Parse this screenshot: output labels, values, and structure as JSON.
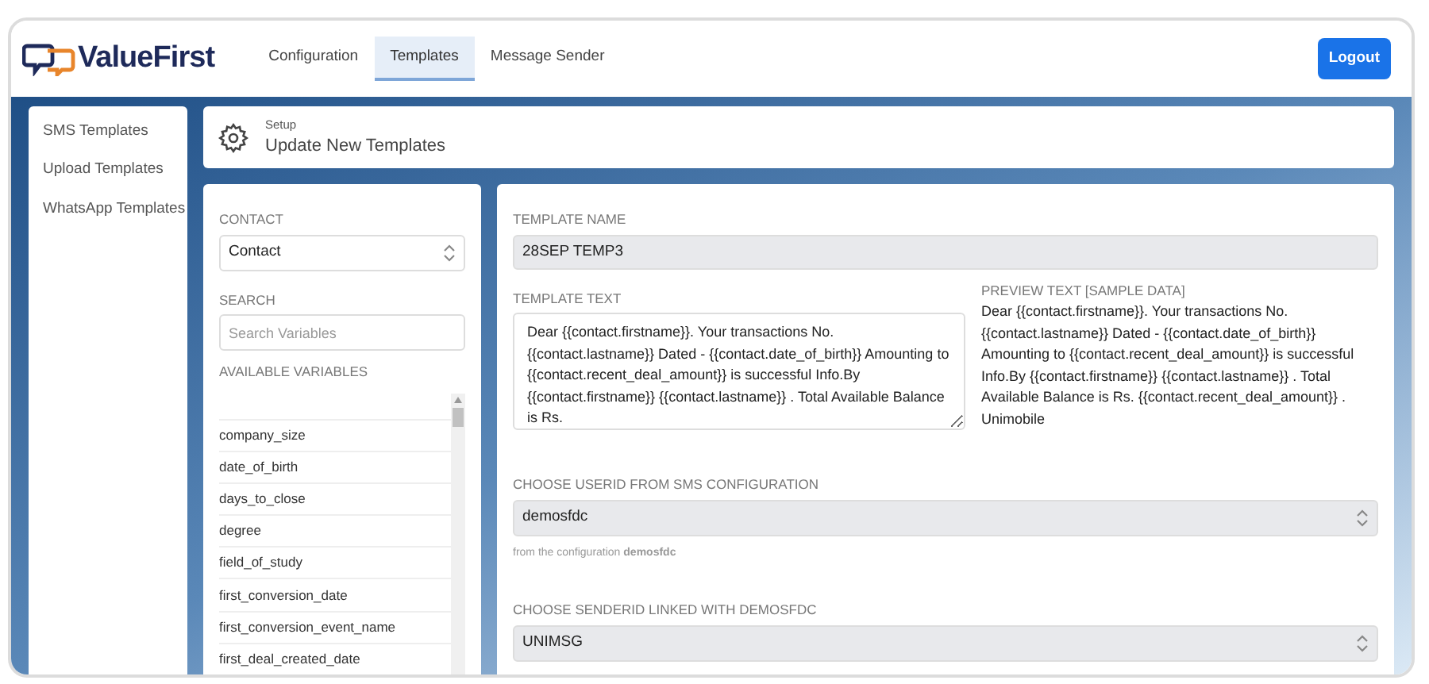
{
  "header": {
    "logo_text": "ValueFirst",
    "tabs": [
      {
        "label": "Configuration",
        "selected": false
      },
      {
        "label": "Templates",
        "selected": true
      },
      {
        "label": "Message Sender",
        "selected": false
      }
    ],
    "logout": "Logout"
  },
  "sidebar": {
    "items": [
      "SMS Templates",
      "Upload Templates",
      "WhatsApp Templates"
    ]
  },
  "page_header": {
    "eyebrow": "Setup",
    "title": "Update New Templates"
  },
  "variables_panel": {
    "contact_label": "CONTACT",
    "contact_value": "Contact",
    "search_label": "SEARCH",
    "search_placeholder": "Search Variables",
    "variables_label": "AVAILABLE VARIABLES",
    "variables": [
      "company_size",
      "date_of_birth",
      "days_to_close",
      "degree",
      "field_of_study",
      "first_conversion_date",
      "first_conversion_event_name",
      "first_deal_created_date"
    ]
  },
  "form": {
    "name_label": "TEMPLATE NAME",
    "name_value": "28SEP TEMP3",
    "text_label": "TEMPLATE TEXT",
    "text_value": "Dear {{contact.firstname}}. Your transactions No. {{contact.lastname}} Dated - {{contact.date_of_birth}} Amounting to {{contact.recent_deal_amount}} is successful Info.By {{contact.firstname}} {{contact.lastname}} . Total Available Balance is Rs.",
    "preview_label": "PREVIEW TEXT [SAMPLE DATA]",
    "preview_text": "Dear {{contact.firstname}}. Your transactions No. {{contact.lastname}} Dated - {{contact.date_of_birth}} Amounting to {{contact.recent_deal_amount}} is successful Info.By {{contact.firstname}} {{contact.lastname}} . Total Available Balance is Rs. {{contact.recent_deal_amount}} . Unimobile",
    "userid_label": "CHOOSE USERID FROM SMS CONFIGURATION",
    "userid_value": "demosfdc",
    "userid_help": "from the configuration **demosfdc**",
    "senderid_label": "CHOOSE SENDERID LINKED WITH DEMOSFDC",
    "senderid_value": "UNIMSG"
  }
}
